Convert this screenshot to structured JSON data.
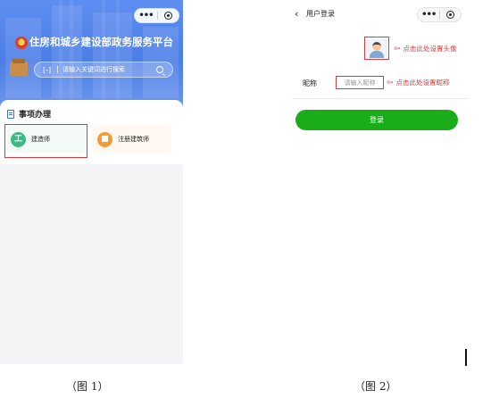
{
  "screen1": {
    "title": "住房和城乡建设部政务服务平台",
    "search_placeholder": "请输入关键词进行搜索",
    "section_title": "事项办理",
    "services": [
      {
        "label": "建造师",
        "icon": "builder-icon",
        "color": "#3cba86",
        "glyph": "工"
      },
      {
        "label": "注册建筑师",
        "icon": "architect-icon",
        "color": "#f29c38",
        "glyph": "■"
      }
    ],
    "capsule": {
      "more": "•••"
    }
  },
  "screen2": {
    "back": "‹",
    "title": "用户登录",
    "avatar_hint": "点击此处设置头像",
    "nickname_label": "昵称",
    "nickname_placeholder": "请输入昵称",
    "nickname_hint": "点击此处设置昵称",
    "login_label": "登录",
    "arrow": "⇦",
    "capsule": {
      "more": "•••"
    }
  },
  "captions": {
    "fig1": "（图 1）",
    "fig2": "（图 2）"
  },
  "colors": {
    "primary_blue": "#4c7ee6",
    "login_green": "#1aad19",
    "highlight_red": "#d83a3a"
  }
}
